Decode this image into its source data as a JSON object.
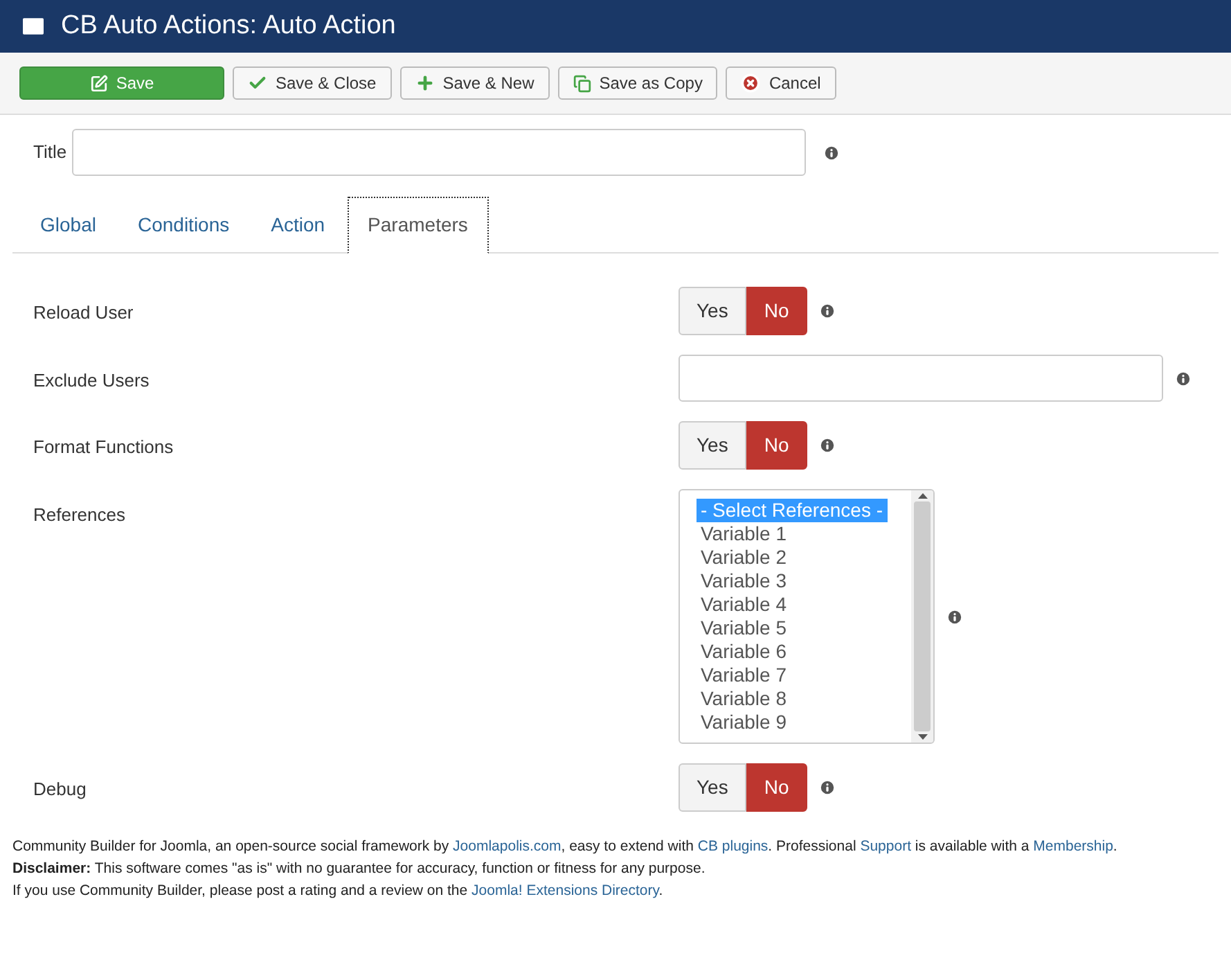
{
  "window": {
    "title": "CB Auto Actions: Auto Action"
  },
  "toolbar": [
    {
      "label": "Save",
      "kind": "primary"
    },
    {
      "label": "Save & Close",
      "kind": "check"
    },
    {
      "label": "Save & New",
      "kind": "plus"
    },
    {
      "label": "Save as Copy",
      "kind": "copy"
    },
    {
      "label": "Cancel",
      "kind": "cancel"
    }
  ],
  "title_field": {
    "label": "Title"
  },
  "tabs": [
    {
      "label": "Global",
      "selected": false
    },
    {
      "label": "Conditions",
      "selected": false
    },
    {
      "label": "Action",
      "selected": false
    },
    {
      "label": "Parameters",
      "selected": true
    }
  ],
  "fields": [
    {
      "kind": "toggle",
      "label": "Reload User",
      "options": [
        {
          "label": "Yes",
          "selected": false
        },
        {
          "label": "No",
          "selected": true
        }
      ]
    },
    {
      "kind": "text",
      "label": "Exclude Users"
    },
    {
      "kind": "toggle",
      "label": "Format Functions",
      "options": [
        {
          "label": "Yes",
          "selected": false
        },
        {
          "label": "No",
          "selected": true
        }
      ]
    },
    {
      "kind": "list",
      "label": "References",
      "options": [
        {
          "label": "- Select References -",
          "selected": true
        },
        {
          "label": "Variable 1",
          "selected": false
        },
        {
          "label": "Variable 2",
          "selected": false
        },
        {
          "label": "Variable 3",
          "selected": false
        },
        {
          "label": "Variable 4",
          "selected": false
        },
        {
          "label": "Variable 5",
          "selected": false
        },
        {
          "label": "Variable 6",
          "selected": false
        },
        {
          "label": "Variable 7",
          "selected": false
        },
        {
          "label": "Variable 8",
          "selected": false
        },
        {
          "label": "Variable 9",
          "selected": false
        }
      ]
    },
    {
      "kind": "toggle",
      "label": "Debug",
      "options": [
        {
          "label": "Yes",
          "selected": false
        },
        {
          "label": "No",
          "selected": true
        }
      ]
    }
  ],
  "footer": [
    [
      {
        "text": "Community Builder for Joomla, an open-source social framework by ",
        "link": false
      },
      {
        "text": "Joomlapolis.com",
        "link": true
      },
      {
        "text": ", easy to extend with ",
        "link": false
      },
      {
        "text": "CB plugins",
        "link": true
      },
      {
        "text": ". Professional ",
        "link": false
      },
      {
        "text": "Support",
        "link": true
      },
      {
        "text": " is available with a ",
        "link": false
      },
      {
        "text": "Membership",
        "link": true
      },
      {
        "text": ".",
        "link": false
      }
    ],
    [
      {
        "text": "**Disclaimer:** This software comes \"as is\" with no guarantee for accuracy, function or fitness for any purpose.",
        "link": false
      }
    ],
    [
      {
        "text": "If you use Community Builder, please post a rating and a review on the ",
        "link": false
      },
      {
        "text": "Joomla! Extensions Directory",
        "link": true
      },
      {
        "text": ".",
        "link": false
      }
    ]
  ]
}
